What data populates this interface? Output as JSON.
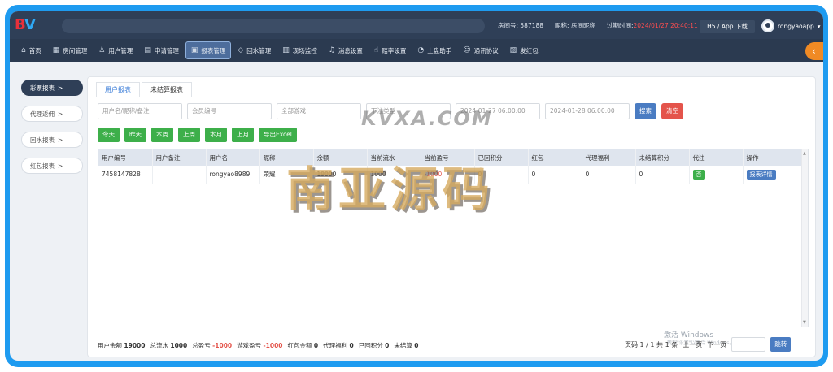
{
  "header": {
    "logo": "BV",
    "room_label": "房间号: 587188",
    "nick_label": "昵称: 房间昵称",
    "expire_label": "过期时间:",
    "expire_value": "2024/01/27 20:40:11",
    "h5_app": "H5 / App 下载",
    "username": "rongyaoapp",
    "user_chevron": "▾"
  },
  "nav": [
    {
      "icon": "⌂",
      "label": "首页"
    },
    {
      "icon": "▦",
      "label": "房间管理"
    },
    {
      "icon": "♙",
      "label": "用户管理"
    },
    {
      "icon": "▤",
      "label": "申请管理"
    },
    {
      "icon": "▣",
      "label": "报表管理"
    },
    {
      "icon": "◇",
      "label": "回水管理"
    },
    {
      "icon": "▥",
      "label": "现场监控"
    },
    {
      "icon": "♫",
      "label": "消息设置"
    },
    {
      "icon": "☝",
      "label": "赔率设置"
    },
    {
      "icon": "◔",
      "label": "上盘助手"
    },
    {
      "icon": "☺",
      "label": "通讯协议"
    },
    {
      "icon": "▨",
      "label": "发红包"
    }
  ],
  "back_icon": "‹",
  "left_menu": [
    {
      "label": "彩票报表",
      "chev": ">"
    },
    {
      "label": "代理返佣",
      "chev": ">"
    },
    {
      "label": "回水报表",
      "chev": ">"
    },
    {
      "label": "红包报表",
      "chev": ">"
    }
  ],
  "tabs": [
    "用户报表",
    "未结算报表"
  ],
  "filters": {
    "user_placeholder": "用户名/昵称/备注",
    "member_placeholder": "会员编号",
    "game_placeholder": "全部游戏",
    "order_placeholder": "下注类型",
    "start_date": "2024-01-27 06:00:00",
    "end_date": "2024-01-28 06:00:00",
    "search": "搜索",
    "clear": "清空"
  },
  "quick": [
    "今天",
    "昨天",
    "本周",
    "上周",
    "本月",
    "上月",
    "导出Excel"
  ],
  "table": {
    "columns": [
      "用户编号",
      "用户备注",
      "用户名",
      "昵称",
      "余额",
      "当前流水",
      "当前盈亏",
      "已回积分",
      "红包",
      "代理福利",
      "未结算积分",
      "代注",
      "操作"
    ],
    "rows": [
      {
        "id": "7458147828",
        "remark": "",
        "username": "rongyao8989",
        "nick": "荣耀",
        "balance": "19000",
        "turnover": "1000",
        "profit": "-1000",
        "returned": "0",
        "redpack": "0",
        "agent": "0",
        "unsettled": "0",
        "proxy_tag": "否",
        "action": "报表详情"
      }
    ]
  },
  "summary": {
    "balance_label": "用户余额",
    "balance": "19000",
    "turnover_label": "总流水",
    "turnover": "1000",
    "profit_label": "总盈亏",
    "profit": "-1000",
    "game_label": "游戏盈亏",
    "game": "-1000",
    "redpack_label": "红包金额",
    "redpack": "0",
    "agent_label": "代理福利",
    "agent": "0",
    "returned_label": "已回积分",
    "returned": "0",
    "unsettled_label": "未结算",
    "unsettled": "0"
  },
  "pager": {
    "info": "页码 1 / 1 共 1 条",
    "prev": "上一页",
    "next": "下一页",
    "go": "跳转"
  },
  "windows_mark": "激活 Windows",
  "windows_sub": "转到\"设置\"以激活 Windows。",
  "watermark": {
    "main": "南亚源码",
    "sub": "KVXA.COM"
  }
}
